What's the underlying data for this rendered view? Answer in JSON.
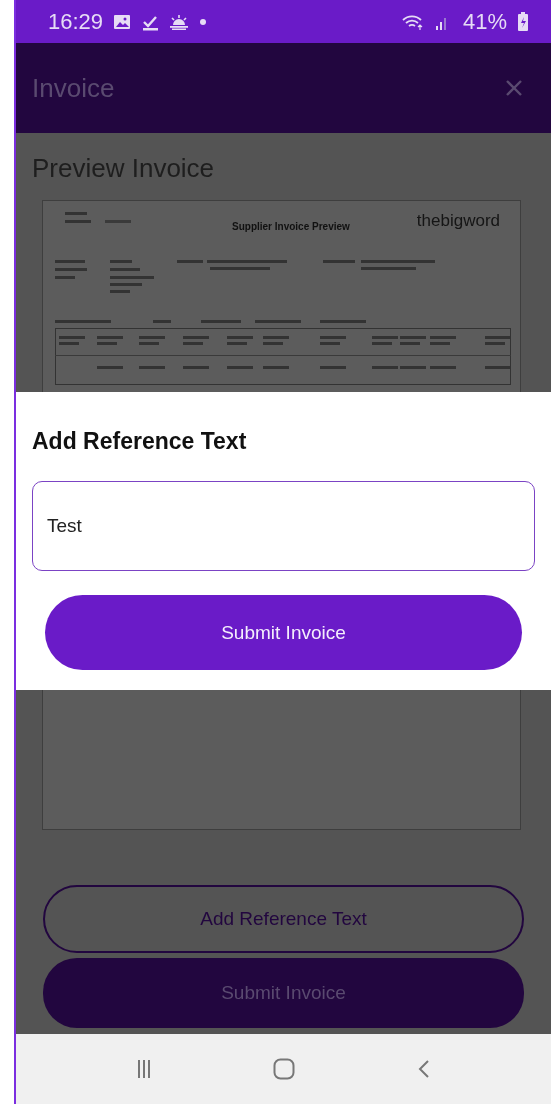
{
  "status_bar": {
    "time": "16:29",
    "battery": "41%"
  },
  "app_bar": {
    "title": "Invoice"
  },
  "page_title": "Preview Invoice",
  "document": {
    "heading": "Supplier Invoice Preview",
    "brand": "thebigword"
  },
  "dialog": {
    "title": "Add Reference Text",
    "field_value": "Test",
    "button": "Submit Invoice"
  },
  "actions": [
    {
      "label": "Add Reference Text",
      "kind": "outlined"
    },
    {
      "label": "Submit Invoice",
      "kind": "filled"
    }
  ]
}
